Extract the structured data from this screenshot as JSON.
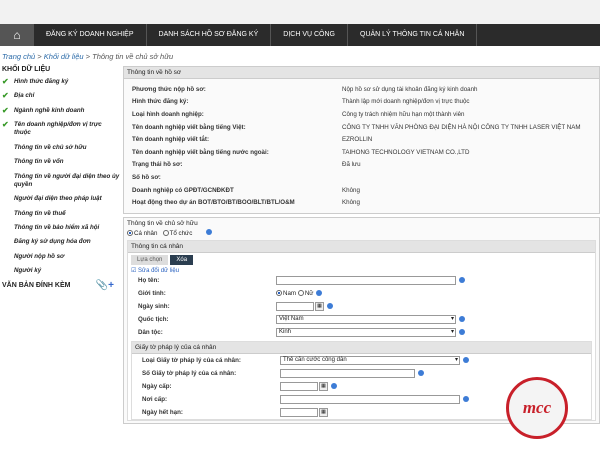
{
  "nav": {
    "items": [
      "ĐĂNG KÝ DOANH NGHIỆP",
      "DANH SÁCH HỒ SƠ ĐĂNG KÝ",
      "DỊCH VỤ CÔNG",
      "QUẢN LÝ THÔNG TIN CÁ NHÂN"
    ]
  },
  "breadcrumb": {
    "home": "Trang chủ",
    "sep": " > ",
    "data": "Khối dữ liệu",
    "current": "Thông tin về chủ sở hữu"
  },
  "sidebar": {
    "title": "KHỐI DỮ LIỆU",
    "items": [
      {
        "label": "Hình thức đăng ký",
        "done": true
      },
      {
        "label": "Địa chỉ",
        "done": true
      },
      {
        "label": "Ngành nghề kinh doanh",
        "done": true
      },
      {
        "label": "Tên doanh nghiệp/đơn vị trực thuộc",
        "done": true
      },
      {
        "label": "Thông tin về chủ sở hữu",
        "done": false
      },
      {
        "label": "Thông tin về vốn",
        "done": false
      },
      {
        "label": "Thông tin về người đại diện theo ủy quyền",
        "done": false
      },
      {
        "label": "Người đại diện theo pháp luật",
        "done": false
      },
      {
        "label": "Thông tin về thuế",
        "done": false
      },
      {
        "label": "Thông tin về bảo hiểm xã hội",
        "done": false
      },
      {
        "label": "Đăng ký sử dụng hóa đơn",
        "done": false
      },
      {
        "label": "Người nộp hồ sơ",
        "done": false
      },
      {
        "label": "Người ký",
        "done": false
      }
    ],
    "attach": "VĂN BẢN ĐÍNH KÈM"
  },
  "info": {
    "title": "Thông tin về hồ sơ",
    "rows": [
      {
        "k": "Phương thức nộp hồ sơ:",
        "v": "Nộp hồ sơ sử dụng tài khoản đăng ký kinh doanh"
      },
      {
        "k": "Hình thức đăng ký:",
        "v": "Thành lập mới doanh nghiệp/đơn vị trực thuộc"
      },
      {
        "k": "Loại hình doanh nghiệp:",
        "v": "Công ty trách nhiệm hữu hạn một thành viên"
      },
      {
        "k": "Tên doanh nghiệp viết bằng tiếng Việt:",
        "v": "CÔNG TY TNHH VĂN PHÒNG ĐẠI DIỆN HÀ NỘI CÔNG TY TNHH LASER VIỆT NAM"
      },
      {
        "k": "Tên doanh nghiệp viết tắt:",
        "v": "EZROLLIN"
      },
      {
        "k": "Tên doanh nghiệp viết bằng tiếng nước ngoài:",
        "v": "TAIHONG TECHNOLOGY VIETNAM CO.,LTD"
      },
      {
        "k": "Trạng thái hồ sơ:",
        "v": "Đã lưu"
      },
      {
        "k": "Số hồ sơ:",
        "v": ""
      },
      {
        "k": "Doanh nghiệp có GPĐT/GCNĐKĐT",
        "v": "Không"
      },
      {
        "k": "Hoạt động theo dự án BOT/BTO/BT/BOO/BLT/BTL/O&M",
        "v": "Không"
      }
    ]
  },
  "owner": {
    "title": "Thông tin về chủ sở hữu",
    "opt_personal": "Cá nhân",
    "opt_org": "Tổ chức",
    "personal_title": "Thông tin cá nhân",
    "btn_choose": "Lựa chọn",
    "btn_delete": "Xóa",
    "edit_label": "Sửa đổi dữ liệu",
    "name_label": "Họ tên:",
    "gender_label": "Giới tính:",
    "male": "Nam",
    "female": "Nữ",
    "dob_label": "Ngày sinh:",
    "nationality_label": "Quốc tịch:",
    "nationality": "Việt Nam",
    "ethnic_label": "Dân tộc:",
    "ethnic": "Kinh"
  },
  "legal": {
    "title": "Giấy tờ pháp lý của cá nhân",
    "type_label": "Loại Giấy tờ pháp lý của cá nhân:",
    "type": "Thẻ căn cước công dân",
    "number_label": "Số Giấy tờ pháp lý của cá nhân:",
    "issue_date_label": "Ngày cấp:",
    "issue_place_label": "Nơi cấp:",
    "expiry_label": "Ngày hết hạn:"
  },
  "logo_text": "mcc"
}
